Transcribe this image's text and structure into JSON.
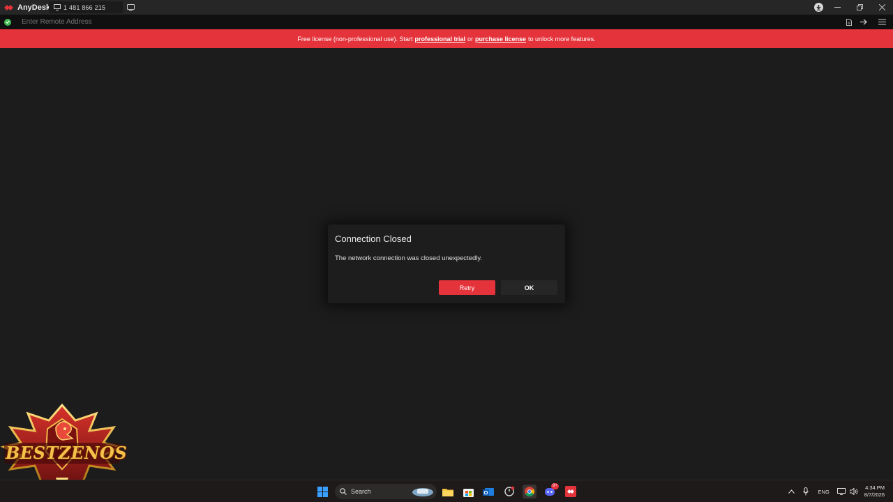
{
  "app": {
    "name": "AnyDesk",
    "session_id": "1 481 866 215"
  },
  "address_bar": {
    "placeholder": "Enter Remote Address"
  },
  "banner": {
    "text_before": "Free license (non-professional use). Start",
    "link_trial": "professional trial",
    "text_middle": "or",
    "link_purchase": "purchase license",
    "text_after": "to unlock more features."
  },
  "dialog": {
    "title": "Connection Closed",
    "message": "The network connection was closed unexpectedly.",
    "retry_label": "Retry",
    "ok_label": "OK"
  },
  "watermark": {
    "text": "BESTZENOS"
  },
  "taskbar": {
    "search_label": "Search",
    "language": "ENG",
    "time": "4:34 PM",
    "date": "8/7/2026",
    "discord_badge": "9+"
  },
  "colors": {
    "accent": "#e5333b",
    "background": "#1c1c1c",
    "status_ok": "#3fb950"
  }
}
